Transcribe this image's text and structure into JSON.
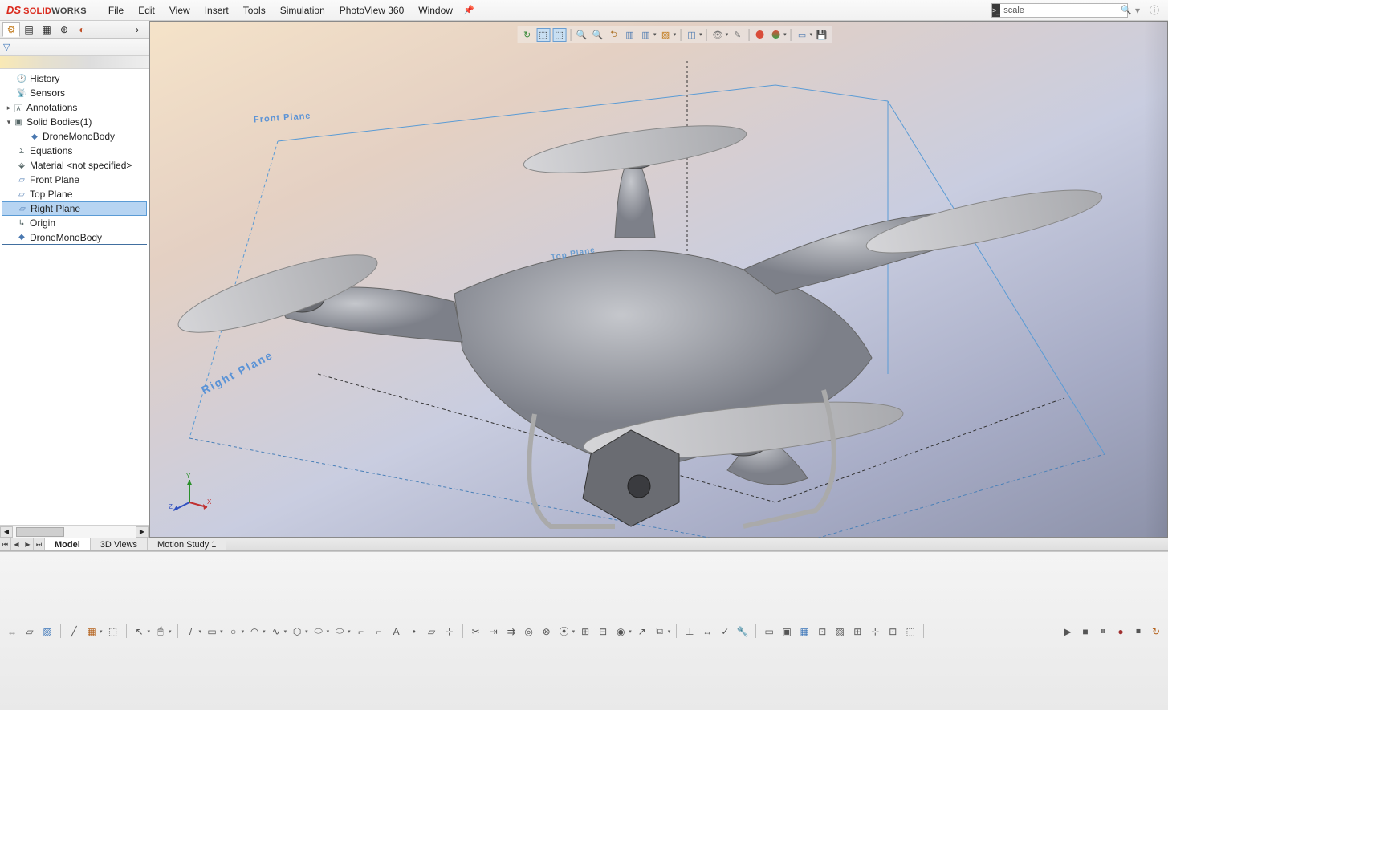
{
  "app": {
    "brand_prefix": "DS",
    "brand_solid": "SOLID",
    "brand_works": "WORKS"
  },
  "menu": {
    "file": "File",
    "edit": "Edit",
    "view": "View",
    "insert": "Insert",
    "tools": "Tools",
    "simulation": "Simulation",
    "photoview": "PhotoView 360",
    "window": "Window"
  },
  "search": {
    "value": "scale"
  },
  "panel_tabs": {
    "feature_manager": "⚙",
    "property_manager": "▤",
    "configuration_manager": "▦",
    "dimxpert": "⊕",
    "display_manager": "◐",
    "expand": "›"
  },
  "filter_icon": "▽",
  "tree": {
    "history": "History",
    "sensors": "Sensors",
    "annotations": "Annotations",
    "solid_bodies": "Solid Bodies(1)",
    "solid_bodies_child": "DroneMonoBody",
    "equations": "Equations",
    "material": "Material <not specified>",
    "front_plane": "Front Plane",
    "top_plane": "Top Plane",
    "right_plane": "Right Plane",
    "origin": "Origin",
    "feature_body": "DroneMonoBody"
  },
  "viewport_labels": {
    "front_plane": "Front Plane",
    "right_plane": "Right Plane",
    "top_plane": "Top Plane"
  },
  "triad": {
    "x": "X",
    "y": "Y",
    "z": "Z"
  },
  "bottom_tabs": {
    "model": "Model",
    "views3d": "3D Views",
    "motion": "Motion Study 1"
  },
  "hud_icons": {
    "redo": "↻",
    "orient": "⬚",
    "select": "⬚",
    "zoomfit": "🔍",
    "zoomarea": "🔍",
    "prev": "⮌",
    "section": "▥",
    "viewsel": "▥",
    "viewset": "▨",
    "display": "◫",
    "hide": "👁",
    "edit": "✎",
    "appearance": "●",
    "scene": "◑",
    "camera": "📷",
    "save": "💾"
  },
  "colors": {
    "appearance_blob1": "#d94c3a",
    "appearance_blob2": "#3aa04a",
    "scene_blob": "#3a7ac0"
  }
}
